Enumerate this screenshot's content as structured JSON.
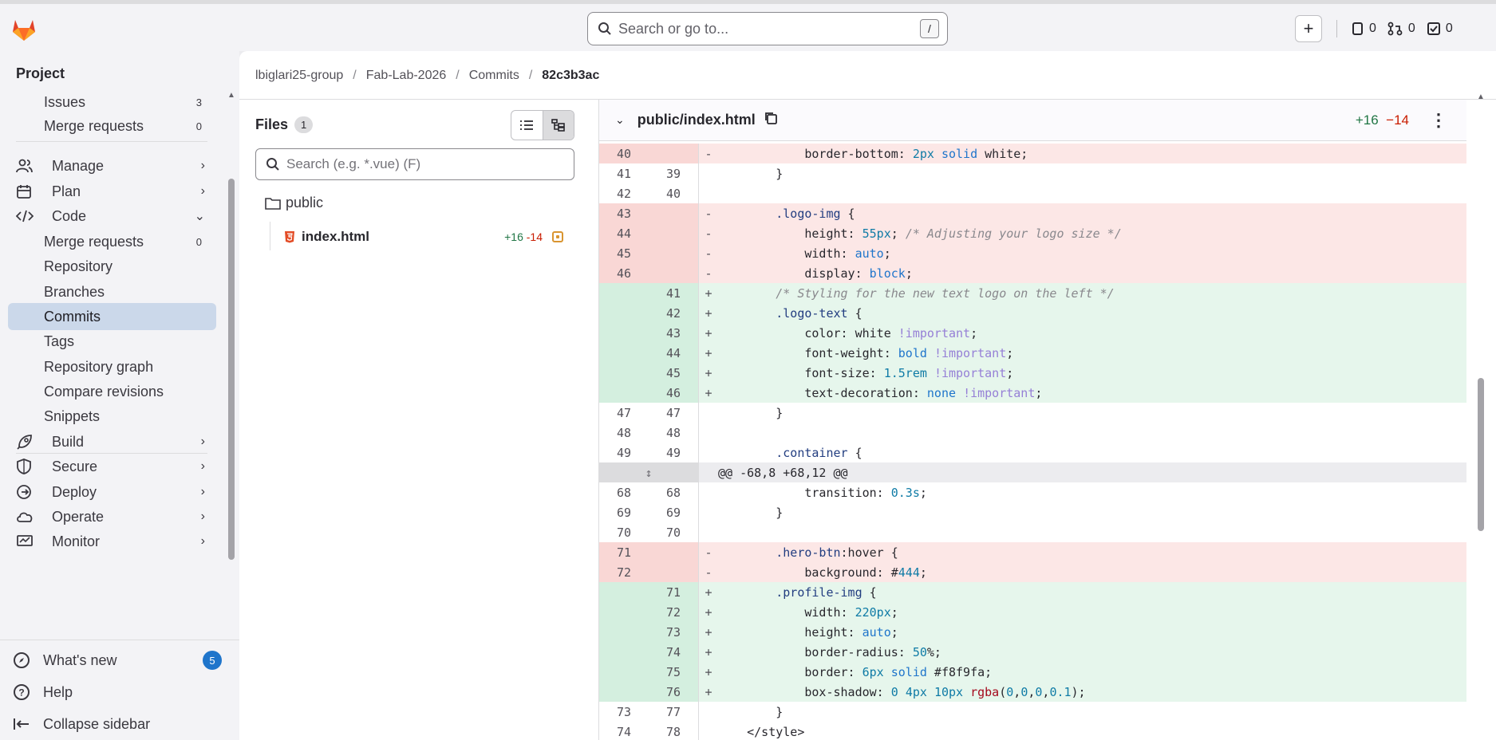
{
  "topbar": {
    "search_placeholder": "Search or go to...",
    "search_shortcut": "/",
    "issues_count": "0",
    "mr_count": "0",
    "todo_count": "0"
  },
  "sidebar": {
    "title": "Project",
    "items": [
      {
        "label": "Issues",
        "badge": "3",
        "kind": "sub"
      },
      {
        "label": "Merge requests",
        "badge": "0",
        "kind": "sub"
      },
      {
        "label": "Manage",
        "kind": "top",
        "icon": "users-icon"
      },
      {
        "label": "Plan",
        "kind": "top",
        "icon": "calendar-icon"
      },
      {
        "label": "Code",
        "kind": "top",
        "icon": "code-icon"
      },
      {
        "label": "Merge requests",
        "badge": "0",
        "kind": "sub"
      },
      {
        "label": "Repository",
        "kind": "sub"
      },
      {
        "label": "Branches",
        "kind": "sub"
      },
      {
        "label": "Commits",
        "kind": "sub",
        "active": true
      },
      {
        "label": "Tags",
        "kind": "sub"
      },
      {
        "label": "Repository graph",
        "kind": "sub"
      },
      {
        "label": "Compare revisions",
        "kind": "sub"
      },
      {
        "label": "Snippets",
        "kind": "sub"
      },
      {
        "label": "Build",
        "kind": "top",
        "icon": "rocket-icon"
      },
      {
        "label": "Secure",
        "kind": "top",
        "icon": "shield-icon"
      },
      {
        "label": "Deploy",
        "kind": "top",
        "icon": "deploy-icon"
      },
      {
        "label": "Operate",
        "kind": "top",
        "icon": "cloud-icon"
      },
      {
        "label": "Monitor",
        "kind": "top",
        "icon": "monitor-icon"
      }
    ],
    "bottom": {
      "whats_new": "What's new",
      "whats_new_badge": "5",
      "help": "Help",
      "collapse": "Collapse sidebar"
    }
  },
  "breadcrumb": [
    "lbiglari25-group",
    "Fab-Lab-2026",
    "Commits",
    "82c3b3ac"
  ],
  "files": {
    "title": "Files",
    "count": "1",
    "search_placeholder": "Search (e.g. *.vue) (F)",
    "folder": "public",
    "file": "index.html",
    "file_added": "+16",
    "file_removed": "-14"
  },
  "diff": {
    "path": "public/index.html",
    "added": "+16",
    "removed": "−14",
    "lines": [
      {
        "t": "del",
        "o": "40",
        "n": "",
        "m": "-",
        "c": "            border-bottom: 2px solid white;"
      },
      {
        "t": "ctx",
        "o": "41",
        "n": "39",
        "m": "",
        "c": "        }"
      },
      {
        "t": "ctx",
        "o": "42",
        "n": "40",
        "m": "",
        "c": ""
      },
      {
        "t": "del",
        "o": "43",
        "n": "",
        "m": "-",
        "c": "        .logo-img {"
      },
      {
        "t": "del",
        "o": "44",
        "n": "",
        "m": "-",
        "c": "            height: 55px; /* Adjusting your logo size */"
      },
      {
        "t": "del",
        "o": "45",
        "n": "",
        "m": "-",
        "c": "            width: auto;"
      },
      {
        "t": "del",
        "o": "46",
        "n": "",
        "m": "-",
        "c": "            display: block;"
      },
      {
        "t": "add",
        "o": "",
        "n": "41",
        "m": "+",
        "c": "        /* Styling for the new text logo on the left */"
      },
      {
        "t": "add",
        "o": "",
        "n": "42",
        "m": "+",
        "c": "        .logo-text {"
      },
      {
        "t": "add",
        "o": "",
        "n": "43",
        "m": "+",
        "c": "            color: white !important;"
      },
      {
        "t": "add",
        "o": "",
        "n": "44",
        "m": "+",
        "c": "            font-weight: bold !important;"
      },
      {
        "t": "add",
        "o": "",
        "n": "45",
        "m": "+",
        "c": "            font-size: 1.5rem !important;"
      },
      {
        "t": "add",
        "o": "",
        "n": "46",
        "m": "+",
        "c": "            text-decoration: none !important;"
      },
      {
        "t": "ctx",
        "o": "47",
        "n": "47",
        "m": "",
        "c": "        }"
      },
      {
        "t": "ctx",
        "o": "48",
        "n": "48",
        "m": "",
        "c": ""
      },
      {
        "t": "ctx",
        "o": "49",
        "n": "49",
        "m": "",
        "c": "        .container {"
      },
      {
        "t": "hunk",
        "o": "",
        "n": "",
        "m": "",
        "c": "@@ -68,8 +68,12 @@"
      },
      {
        "t": "ctx",
        "o": "68",
        "n": "68",
        "m": "",
        "c": "            transition: 0.3s;"
      },
      {
        "t": "ctx",
        "o": "69",
        "n": "69",
        "m": "",
        "c": "        }"
      },
      {
        "t": "ctx",
        "o": "70",
        "n": "70",
        "m": "",
        "c": ""
      },
      {
        "t": "del",
        "o": "71",
        "n": "",
        "m": "-",
        "c": "        .hero-btn:hover {"
      },
      {
        "t": "del",
        "o": "72",
        "n": "",
        "m": "-",
        "c": "            background: #444;"
      },
      {
        "t": "add",
        "o": "",
        "n": "71",
        "m": "+",
        "c": "        .profile-img {"
      },
      {
        "t": "add",
        "o": "",
        "n": "72",
        "m": "+",
        "c": "            width: 220px;"
      },
      {
        "t": "add",
        "o": "",
        "n": "73",
        "m": "+",
        "c": "            height: auto;"
      },
      {
        "t": "add",
        "o": "",
        "n": "74",
        "m": "+",
        "c": "            border-radius: 50%;"
      },
      {
        "t": "add",
        "o": "",
        "n": "75",
        "m": "+",
        "c": "            border: 6px solid #f8f9fa;"
      },
      {
        "t": "add",
        "o": "",
        "n": "76",
        "m": "+",
        "c": "            box-shadow: 0 4px 10px rgba(0,0,0,0.1);"
      },
      {
        "t": "ctx",
        "o": "73",
        "n": "77",
        "m": "",
        "c": "        }"
      },
      {
        "t": "ctx",
        "o": "74",
        "n": "78",
        "m": "",
        "c": "    </style>"
      }
    ]
  }
}
